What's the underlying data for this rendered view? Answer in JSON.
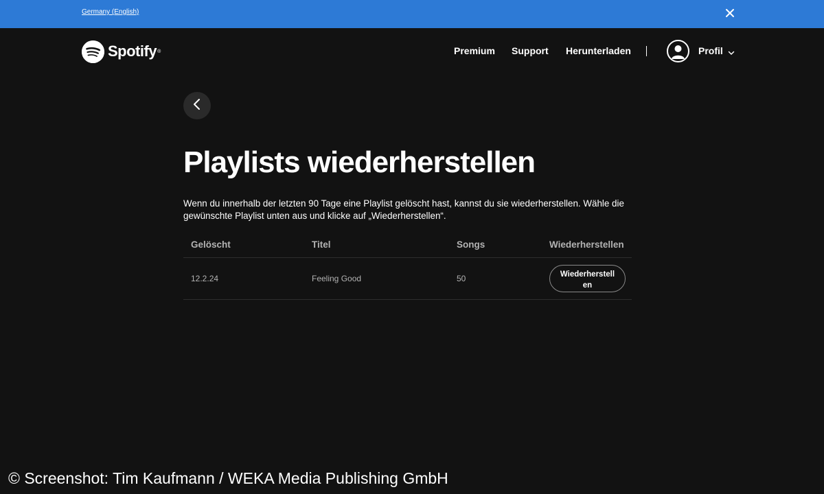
{
  "locale_bar": {
    "link_label": "Germany (English)",
    "background": "#2d7ad6",
    "close_icon": "close-icon"
  },
  "header": {
    "logo_text": "Spotify",
    "logo_icon": "spotify-logo-icon",
    "nav": {
      "premium": "Premium",
      "support": "Support",
      "download": "Herunterladen"
    },
    "profile_label": "Profil",
    "avatar_icon": "user-icon",
    "profile_chevron_icon": "chevron-down-icon"
  },
  "main": {
    "back_icon": "chevron-left-icon",
    "title": "Playlists wiederherstellen",
    "description": "Wenn du innerhalb der letzten 90 Tage eine Playlist gelöscht hast, kannst du sie wiederherstellen. Wähle die gewünschte Playlist unten aus und klicke auf „Wiederherstellen“.",
    "table": {
      "headers": {
        "deleted": "Gelöscht",
        "title": "Titel",
        "songs": "Songs",
        "restore": "Wiederherstellen"
      },
      "rows": [
        {
          "deleted": "12.2.24",
          "title": "Feeling Good",
          "songs": "50",
          "restore_label": "Wiederherstellen"
        }
      ]
    }
  },
  "watermark": "© Screenshot: Tim Kaufmann / WEKA Media Publishing GmbH",
  "colors": {
    "background": "#121212",
    "text_primary": "#ffffff",
    "text_secondary": "#b3b3b3",
    "accent_banner": "#2d7ad6"
  }
}
